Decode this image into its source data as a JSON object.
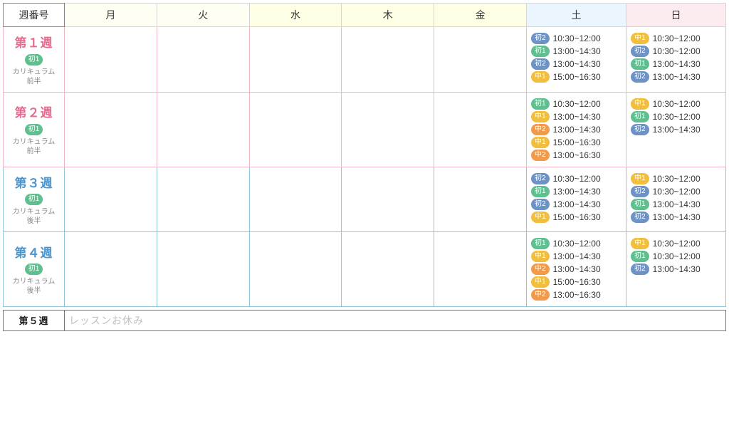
{
  "headers": {
    "weeknum": "週番号",
    "days": [
      "月",
      "火",
      "水",
      "木",
      "金",
      "土",
      "日"
    ]
  },
  "levels": {
    "b1": "初1",
    "b2": "初2",
    "i1": "中1",
    "i2": "中2"
  },
  "curriculum": {
    "first": "カリキュラム\n前半",
    "second": "カリキュラム\n後半"
  },
  "weeks": [
    {
      "id": "w1",
      "title": "第１週",
      "group": "pink",
      "badge": "b1",
      "curr": "first",
      "sat": [
        {
          "lv": "b2",
          "time": "10:30~12:00"
        },
        {
          "lv": "b1",
          "time": "13:00~14:30"
        },
        {
          "lv": "b2",
          "time": "13:00~14:30"
        },
        {
          "lv": "i1",
          "time": "15:00~16:30"
        }
      ],
      "sun": [
        {
          "lv": "i1",
          "time": "10:30~12:00"
        },
        {
          "lv": "b2",
          "time": "10:30~12:00"
        },
        {
          "lv": "b1",
          "time": "13:00~14:30"
        },
        {
          "lv": "b2",
          "time": "13:00~14:30"
        }
      ]
    },
    {
      "id": "w2",
      "title": "第２週",
      "group": "pink",
      "badge": "b1",
      "curr": "first",
      "sat": [
        {
          "lv": "b1",
          "time": "10:30~12:00"
        },
        {
          "lv": "i1",
          "time": "13:00~14:30"
        },
        {
          "lv": "i2",
          "time": "13:00~14:30"
        },
        {
          "lv": "i1",
          "time": "15:00~16:30"
        },
        {
          "lv": "i2",
          "time": "13:00~16:30"
        }
      ],
      "sun": [
        {
          "lv": "i1",
          "time": "10:30~12:00"
        },
        {
          "lv": "b1",
          "time": "10:30~12:00"
        },
        {
          "lv": "b2",
          "time": "13:00~14:30"
        }
      ]
    },
    {
      "id": "w3",
      "title": "第３週",
      "group": "blue",
      "badge": "b1",
      "curr": "second",
      "sat": [
        {
          "lv": "b2",
          "time": "10:30~12:00"
        },
        {
          "lv": "b1",
          "time": "13:00~14:30"
        },
        {
          "lv": "b2",
          "time": "13:00~14:30"
        },
        {
          "lv": "i1",
          "time": "15:00~16:30"
        }
      ],
      "sun": [
        {
          "lv": "i1",
          "time": "10:30~12:00"
        },
        {
          "lv": "b2",
          "time": "10:30~12:00"
        },
        {
          "lv": "b1",
          "time": "13:00~14:30"
        },
        {
          "lv": "b2",
          "time": "13:00~14:30"
        }
      ]
    },
    {
      "id": "w4",
      "title": "第４週",
      "group": "blue",
      "badge": "b1",
      "curr": "second",
      "sat": [
        {
          "lv": "b1",
          "time": "10:30~12:00"
        },
        {
          "lv": "i1",
          "time": "13:00~14:30"
        },
        {
          "lv": "i2",
          "time": "13:00~14:30"
        },
        {
          "lv": "i1",
          "time": "15:00~16:30"
        },
        {
          "lv": "i2",
          "time": "13:00~16:30"
        }
      ],
      "sun": [
        {
          "lv": "i1",
          "time": "10:30~12:00"
        },
        {
          "lv": "b1",
          "time": "10:30~12:00"
        },
        {
          "lv": "b2",
          "time": "13:00~14:30"
        }
      ]
    }
  ],
  "week5": {
    "title": "第５週",
    "note": "レッスンお休み"
  }
}
